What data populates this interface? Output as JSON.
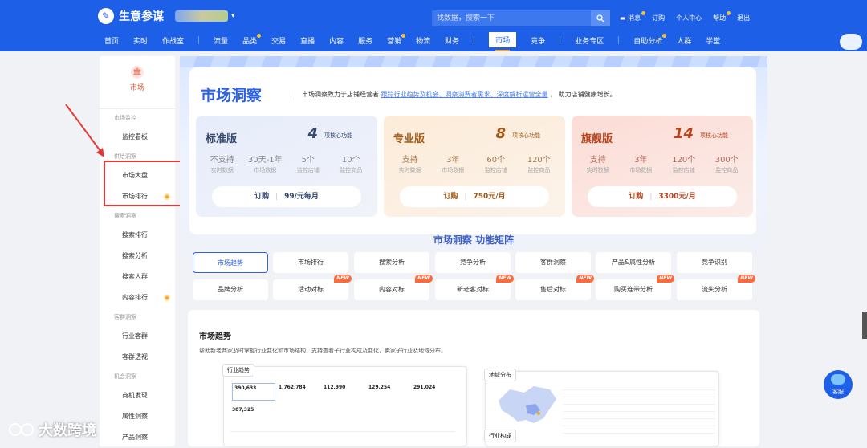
{
  "header": {
    "logo_glyph": "✎",
    "app_name": "生意参谋",
    "search_placeholder": "找数据，搜索一下",
    "links": [
      "消息",
      "订购",
      "个人中心",
      "帮助",
      "退出"
    ]
  },
  "nav": {
    "items": [
      "首页",
      "实时",
      "作战室",
      "流量",
      "品类",
      "交易",
      "直播",
      "内容",
      "服务",
      "营销",
      "物流",
      "财务",
      "市场",
      "竞争",
      "业务专区",
      "自助分析",
      "人群",
      "学堂"
    ],
    "active": "市场"
  },
  "sidebar": {
    "head_icon": "🏛",
    "title": "市场",
    "groups": [
      {
        "label": "市场监控",
        "items": [
          "监控看板"
        ]
      },
      {
        "label": "供给洞察",
        "items": [
          "市场大盘",
          "市场排行"
        ]
      },
      {
        "label": "搜索洞察",
        "items": [
          "搜索排行",
          "搜索分析",
          "搜索人群",
          "内容排行"
        ]
      },
      {
        "label": "客群洞察",
        "items": [
          "行业客群",
          "客群透视"
        ]
      },
      {
        "label": "机会洞察",
        "items": [
          "商机发现",
          "属性洞察",
          "产品洞察"
        ]
      }
    ]
  },
  "hero": {
    "title": "市场洞察",
    "desc_prefix": "市场洞察致力于店铺经营者",
    "desc_links": "跟踪行业趋势及机会、洞察消费者需求、深度解析运营全量",
    "desc_suffix": "，  助力店铺健康增长。"
  },
  "plans": [
    {
      "name": "标准版",
      "num": "4",
      "feat": "项核心功能",
      "stats": [
        {
          "v": "不支持",
          "l": "实时数据"
        },
        {
          "v": "30天-1年",
          "l": "市场数据"
        },
        {
          "v": "5个",
          "l": "监控店铺"
        },
        {
          "v": "10个",
          "l": "监控商品"
        }
      ],
      "btn": "订购",
      "price": "99/元每月"
    },
    {
      "name": "专业版",
      "num": "8",
      "feat": "项核心功能",
      "stats": [
        {
          "v": "支持",
          "l": "实时数据"
        },
        {
          "v": "3年",
          "l": "市场数据"
        },
        {
          "v": "60个",
          "l": "监控店铺"
        },
        {
          "v": "120个",
          "l": "监控商品"
        }
      ],
      "btn": "订购",
      "price": "750元/月"
    },
    {
      "name": "旗舰版",
      "num": "14",
      "feat": "项核心功能",
      "stats": [
        {
          "v": "支持",
          "l": "实时数据"
        },
        {
          "v": "3年",
          "l": "市场数据"
        },
        {
          "v": "120个",
          "l": "监控店铺"
        },
        {
          "v": "300个",
          "l": "监控商品"
        }
      ],
      "btn": "订购",
      "price": "3300元/月"
    }
  ],
  "matrix": {
    "title": "市场洞察 功能矩阵",
    "new_tag": "NEW",
    "row1": [
      "市场趋势",
      "市场排行",
      "搜索分析",
      "竞争分析",
      "客群洞察",
      "产品&属性分析",
      "竞争识别"
    ],
    "row2": [
      "品牌分析",
      "活动对标",
      "内容对标",
      "新老客对标",
      "售后对标",
      "购买连带分析",
      "流失分析"
    ]
  },
  "trend": {
    "title": "市场趋势",
    "desc": "帮助新老商家及时掌握行业变化和市场结构，支持查看子行业构成及变化，卖家子行业及地域分布。",
    "preview1_tab": "行业趋势",
    "preview1_values": [
      "390,633",
      "1,762,784",
      "112,990",
      "129,254",
      "291,024",
      "387,325"
    ],
    "preview2_tab": "地域分布",
    "preview3_tab": "行业构成"
  },
  "kefu": "客服",
  "watermark": "大数跨境"
}
